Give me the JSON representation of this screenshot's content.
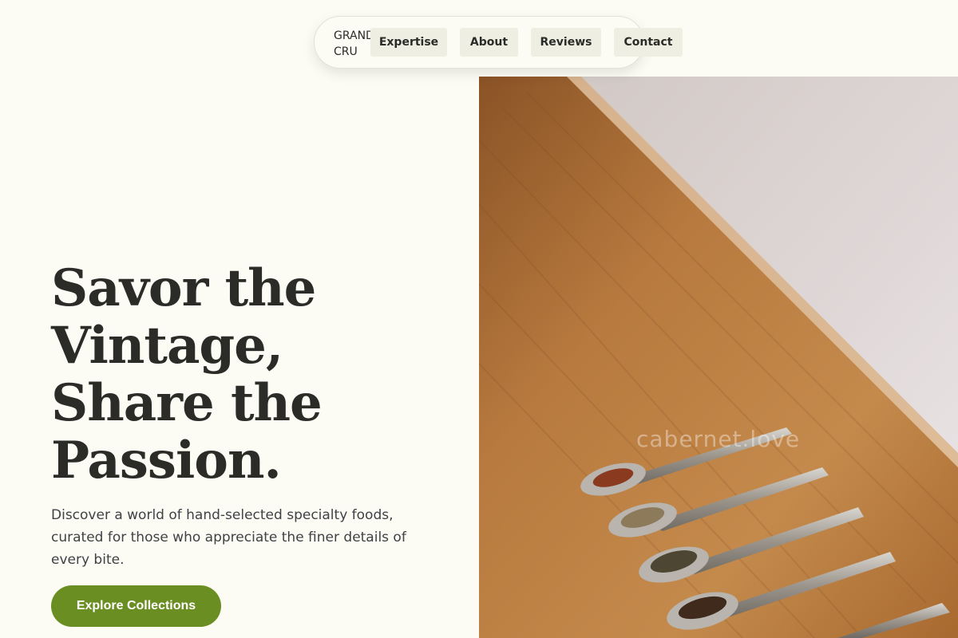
{
  "nav": {
    "brand_line1": "GRAND",
    "brand_line2": "CRU",
    "links": [
      {
        "label": "Expertise"
      },
      {
        "label": "About"
      },
      {
        "label": "Reviews"
      },
      {
        "label": "Contact"
      }
    ]
  },
  "hero": {
    "title_lines": [
      "Savor the",
      "Vintage,",
      "Share the",
      "Passion."
    ],
    "description": "Discover a world of hand-selected specialty foods, curated for those who appreciate the finer details of every bite.",
    "cta_label": "Explore Collections"
  },
  "photo": {
    "watermark": "cabernet.love",
    "subject": "silver spoons with spices on a wooden board"
  },
  "colors": {
    "background": "#fcfcf4",
    "accent": "#6b8e23",
    "text": "#2b2b28",
    "nav_link_bg": "#eeefe2",
    "wood": "#b7773a"
  }
}
